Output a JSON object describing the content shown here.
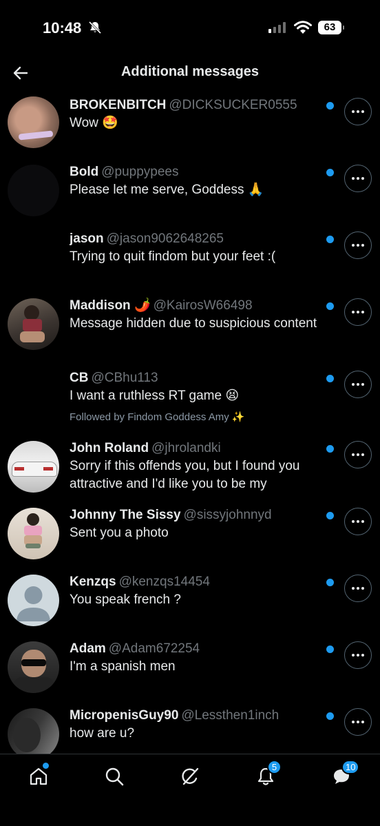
{
  "status_bar": {
    "time": "10:48",
    "battery": "63"
  },
  "header": {
    "title": "Additional messages"
  },
  "messages": [
    {
      "name": "BROKENBITCH",
      "handle": "@DICKSUCKER0555",
      "preview": "Wow 🤩",
      "followed_by": ""
    },
    {
      "name": "Bold",
      "handle": "@puppypees",
      "preview": "Please let me serve, Goddess 🙏",
      "followed_by": ""
    },
    {
      "name": "jason",
      "handle": "@jason9062648265",
      "preview": "Trying to quit findom but your feet :(",
      "followed_by": ""
    },
    {
      "name": "Maddison 🌶️",
      "handle": "@KairosW66498",
      "preview": "Message hidden due to suspicious content",
      "followed_by": ""
    },
    {
      "name": "CB",
      "handle": "@CBhu113",
      "preview": "I want a ruthless RT game 😫",
      "followed_by": "Followed by Findom Goddess Amy ✨"
    },
    {
      "name": "John Roland",
      "handle": "@jhrolandki",
      "preview": "Sorry if this offends you, but I found you attractive and I'd like you to be my",
      "followed_by": ""
    },
    {
      "name": "Johnny The Sissy",
      "handle": "@sissyjohnnyd",
      "preview": "Sent you a photo",
      "followed_by": ""
    },
    {
      "name": "Kenzqs",
      "handle": "@kenzqs14454",
      "preview": "You speak french ?",
      "followed_by": ""
    },
    {
      "name": "Adam",
      "handle": "@Adam672254",
      "preview": "I'm a spanish men",
      "followed_by": ""
    },
    {
      "name": "MicropenisGuy90",
      "handle": "@Lessthen1inch",
      "preview": "how are u?",
      "followed_by": ""
    }
  ],
  "nav": {
    "home_icon": "home-icon",
    "search_icon": "search-icon",
    "grok_icon": "grok-icon",
    "notifications_badge": "5",
    "messages_badge": "10"
  },
  "colors": {
    "accent": "#1d9bf0",
    "background": "#000000",
    "handle": "#71767b"
  }
}
